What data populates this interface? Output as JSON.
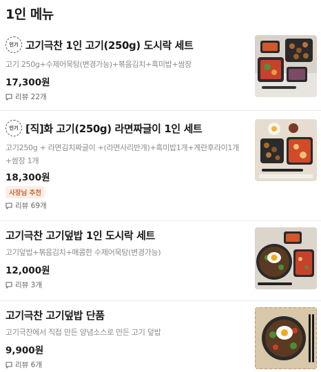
{
  "section": {
    "title": "1인 메뉴"
  },
  "badges": {
    "popular": "인기",
    "owner_pick": "사장님 추천"
  },
  "items": [
    {
      "name": "고기극찬 1인 고기(250g) 도시락 세트",
      "description": "고기 250g+수제어묵탕(변경가능)+볶음김치+흑미밥+쌈장",
      "price": "17,300원",
      "reviews": "리뷰 22개",
      "popular": true,
      "image": "lunchbox-set-photo"
    },
    {
      "name": "[직]화 고기(250g) 라면짜글이 1인 세트",
      "description": "고기250g + 라면김치짜글이 +(라면사리반개)+흑미밥1개+계란후라이1개+쌈장 1개",
      "price": "18,300원",
      "reviews": "리뷰 69개",
      "popular": true,
      "owner_pick": true,
      "image": "ramen-jjageuri-set-photo"
    },
    {
      "name": "고기극찬 고기덮밥 1인 도시락 세트",
      "description": "고기덮밥+볶음김치+매콤한 수제어묵탕(변경가능)",
      "price": "12,000원",
      "reviews": "리뷰 3개",
      "image": "rice-bowl-set-photo"
    },
    {
      "name": "고기극찬 고기덮밥 단품",
      "description": "고기극찬에서 직접 만든 양념소스로 만든 고기 덮밥",
      "price": "9,900원",
      "reviews": "리뷰 6개",
      "image": "rice-bowl-single-photo"
    }
  ]
}
